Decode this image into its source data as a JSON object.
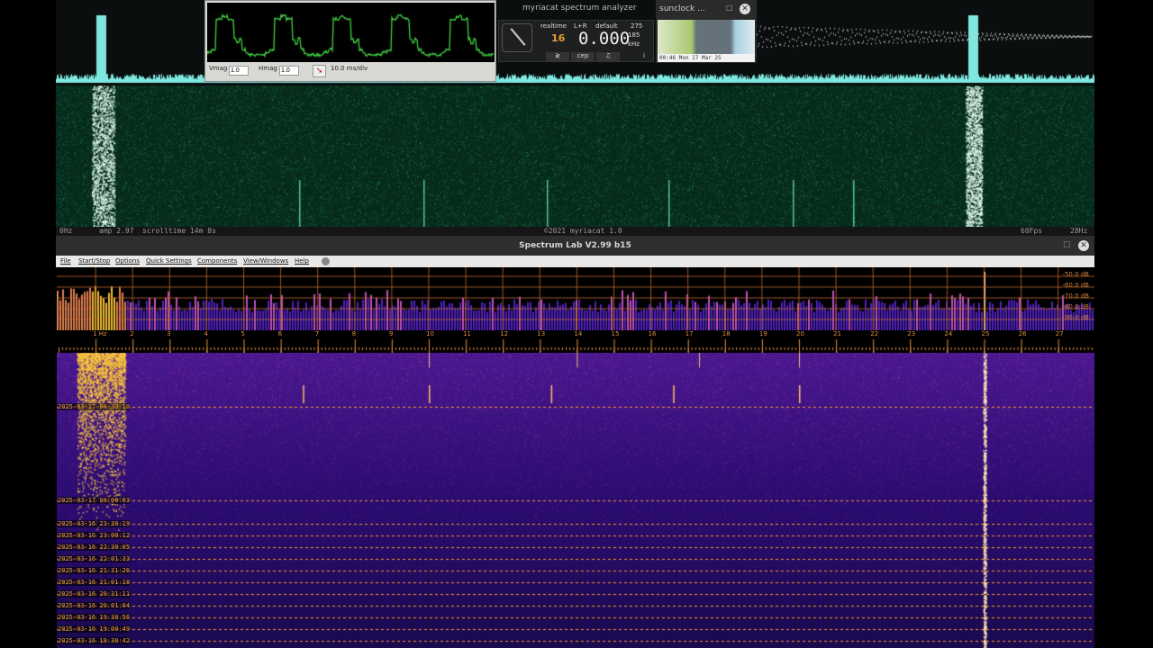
{
  "myriacat": {
    "title": "myriacat spectrum analyzer",
    "status": {
      "freq_min": "0Hz",
      "amp": "amp 2.97",
      "scrolltime": "scrolltime 14m 8s",
      "copyright": "©2021 myriacat 1.0",
      "fps": "60Fps",
      "freq_max": "28Hz"
    },
    "widget": {
      "mode": "realtime",
      "channel": "L+R",
      "preset": "default",
      "num_top": "275",
      "digits_small": "16",
      "frequency": "0.000",
      "num_right": "185",
      "unit": "kHz",
      "buttons": [
        "≷",
        "cep",
        "♫"
      ],
      "info": "i"
    },
    "accent": "#3fe0a0"
  },
  "oscilloscope": {
    "vmag_label": "Vmag",
    "vmag_value": "1.0",
    "hmag_label": "Hmag",
    "hmag_value": "1.0",
    "timebase": "10.0 ms/div",
    "trace_color": "#40d040"
  },
  "sunclock": {
    "title": "sunclock ...",
    "time": "00:46 Mon 17 Mar 25"
  },
  "spectrum_lab": {
    "title": "Spectrum Lab V2.99 b15",
    "menu": [
      "File",
      "Start/Stop",
      "Options",
      "Quick Settings",
      "Components",
      "View/Windows",
      "Help"
    ],
    "db_labels": [
      "-50.0 dB",
      "-60.0 dB",
      "-70.0 dB",
      "-80.0 dB",
      "-90.0 dB"
    ],
    "freq_labels": [
      "1 Hz",
      "2",
      "3",
      "4",
      "5",
      "6",
      "7",
      "8",
      "9",
      "10",
      "11",
      "12",
      "13",
      "14",
      "15",
      "16",
      "17",
      "18",
      "19",
      "20",
      "21",
      "22",
      "23",
      "24",
      "25",
      "26",
      "27"
    ],
    "timestamps": [
      "2025-03-17 00:30:10",
      "2025-03-17 00:00:03",
      "2025-03-16 23:30:19",
      "2025-03-16 23:00:12",
      "2025-03-16 22:30:05",
      "2025-03-16 22:01:33",
      "2025-03-16 21:31:26",
      "2025-03-16 21:01:18",
      "2025-03-16 20:31:11",
      "2025-03-16 20:01:04",
      "2025-03-16 19:30:56",
      "2025-03-16 19:00:49",
      "2025-03-16 18:30:42"
    ],
    "colors": {
      "grid": "#c06a30",
      "marker": "#ff9a20",
      "background": "#1a0a50"
    }
  }
}
